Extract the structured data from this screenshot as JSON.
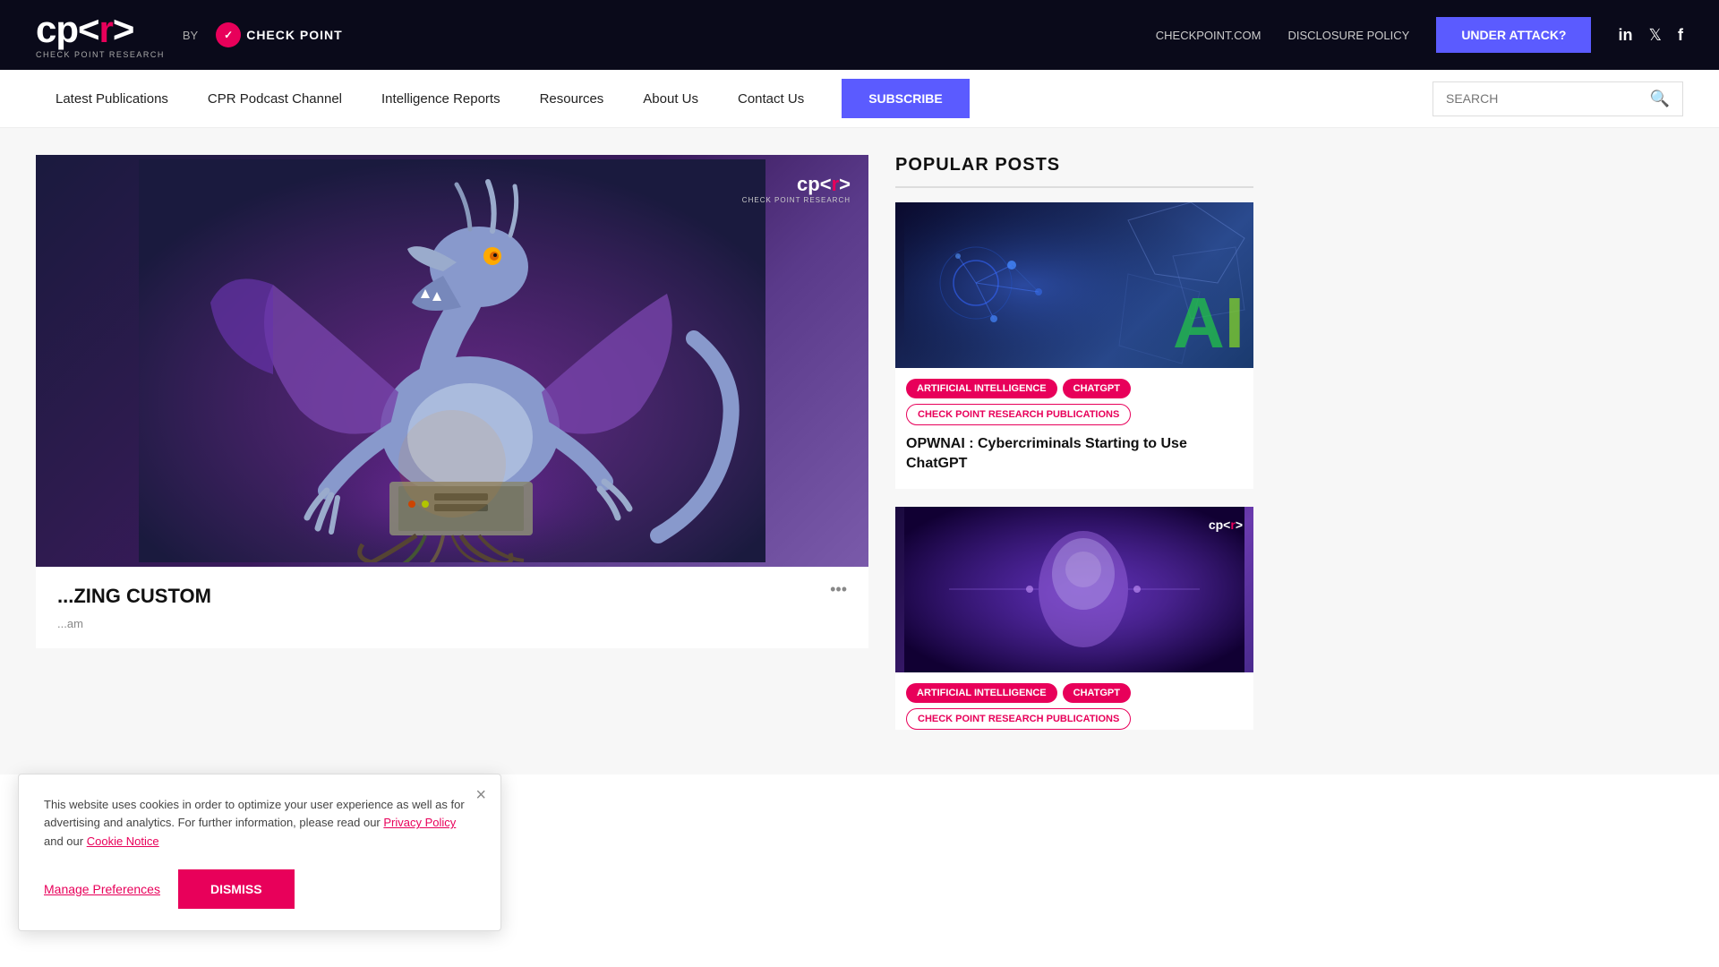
{
  "topbar": {
    "checkpoint_link": "CHECKPOINT.COM",
    "disclosure_link": "DISCLOSURE POLICY",
    "under_attack": "UNDER ATTACK?"
  },
  "logo": {
    "cpr_text": "cp<r>",
    "subtitle": "CHECK POINT RESEARCH",
    "by": "BY",
    "check_point": "CHECK POINT"
  },
  "nav": {
    "items": [
      {
        "label": "Latest Publications",
        "id": "latest-publications"
      },
      {
        "label": "CPR Podcast Channel",
        "id": "cpr-podcast"
      },
      {
        "label": "Intelligence Reports",
        "id": "intelligence-reports"
      },
      {
        "label": "Resources",
        "id": "resources"
      },
      {
        "label": "About Us",
        "id": "about-us"
      },
      {
        "label": "Contact Us",
        "id": "contact-us"
      }
    ],
    "subscribe_label": "SUBSCRIBE",
    "search_placeholder": "SEARCH"
  },
  "featured": {
    "title": "...ZING CUSTOM",
    "meta": "...am",
    "more_icon": "•••"
  },
  "sidebar": {
    "popular_posts_title": "POPULAR POSTS",
    "posts": [
      {
        "id": "post-1",
        "tags": [
          "ARTIFICIAL INTELLIGENCE",
          "CHATGPT",
          "CHECK POINT RESEARCH PUBLICATIONS"
        ],
        "title": "OPWNAI : Cybercriminals Starting to Use ChatGPT"
      },
      {
        "id": "post-2",
        "tags": [
          "ARTIFICIAL INTELLIGENCE",
          "CHATGPT",
          "CHECK POINT RESEARCH PUBLICATIONS"
        ],
        "title": ""
      }
    ]
  },
  "cookie": {
    "text": "This website uses cookies in order to optimize your user experience as well as for advertising and analytics. For further information, please read our",
    "privacy_policy": "Privacy Policy",
    "and_our": "and our",
    "cookie_notice": "Cookie Notice",
    "manage_prefs": "Manage Preferences",
    "dismiss": "DISMISS"
  }
}
